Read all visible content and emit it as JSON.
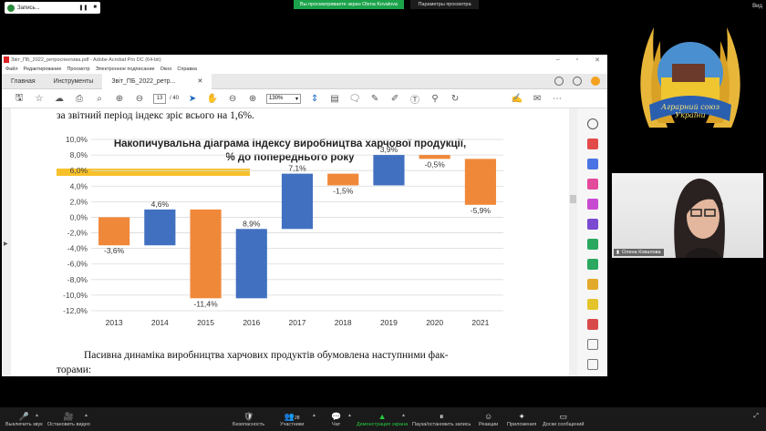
{
  "zoom": {
    "recording_label": "Запись...",
    "banner": "Вы просматриваете экран Olena Kovalova",
    "view_options": "Параметры просмотра",
    "top_right": "Вид",
    "bottom": [
      {
        "id": "mute",
        "label": "Выключить звук",
        "glyph": "🎤"
      },
      {
        "id": "video",
        "label": "Остановить видео",
        "glyph": "🎥"
      },
      {
        "id": "security",
        "label": "Безопасность",
        "glyph": "🛡"
      },
      {
        "id": "participants",
        "label": "Участники",
        "glyph": "👥",
        "count": "28"
      },
      {
        "id": "chat",
        "label": "Чат",
        "glyph": "💬"
      },
      {
        "id": "share",
        "label": "Демонстрация экрана",
        "glyph": "▲"
      },
      {
        "id": "pause",
        "label": "Пауза/остановить запись",
        "glyph": "⏸"
      },
      {
        "id": "reactions",
        "label": "Реакции",
        "glyph": "☺"
      },
      {
        "id": "apps",
        "label": "Приложения",
        "glyph": "✦"
      },
      {
        "id": "whiteboard",
        "label": "Доски сообщений",
        "glyph": "▭"
      }
    ]
  },
  "acrobat": {
    "title": "Звіт_ПБ_2022_ретроспектива.pdf - Adobe Acrobat Pro DC (64-bit)",
    "menu": [
      "Файл",
      "Редактирование",
      "Просмотр",
      "Электронное подписание",
      "Окно",
      "Справка"
    ],
    "tabs": {
      "home": "Главная",
      "tools": "Инструменты",
      "doc": "Звіт_ПБ_2022_ретр..."
    },
    "page_current": "13",
    "page_total": "/ 40",
    "zoom": "130%"
  },
  "document": {
    "line_top": "за звітний період індекс зріс всього на 1,6%.",
    "paragraph_1": "Пасивна динаміка виробництва харчових продуктів обумовлена наступними фак-",
    "paragraph_2": "торами:"
  },
  "chart_data": {
    "type": "waterfall",
    "title_line1": "Накопичувальна діаграма індексу виробництва харчової продукції,",
    "title_line2": "% до попереднього року",
    "categories": [
      "2013",
      "2014",
      "2015",
      "2016",
      "2017",
      "2018",
      "2019",
      "2020",
      "2021"
    ],
    "changes": [
      -3.6,
      4.6,
      -11.4,
      8.9,
      7.1,
      -1.5,
      3.9,
      -0.5,
      -5.9
    ],
    "labels": [
      "-3,6%",
      "4,6%",
      "-11,4%",
      "8,9%",
      "7,1%",
      "-1,5%",
      "3,9%",
      "-0,5%",
      "-5,9%"
    ],
    "yticks": [
      "10,0%",
      "8,0%",
      "6,0%",
      "4,0%",
      "2,0%",
      "0,0%",
      "-2,0%",
      "-4,0%",
      "-6,0%",
      "-8,0%",
      "-10,0%",
      "-12,0%"
    ],
    "ylim": [
      -12,
      10
    ],
    "colors": {
      "negative": "#f0883a",
      "positive": "#4170c0",
      "accent_bar": "#f7c12b"
    },
    "grid": true
  },
  "presenter": {
    "name": "Олена Ковалова",
    "brand_text": "Аграрний союз України"
  }
}
